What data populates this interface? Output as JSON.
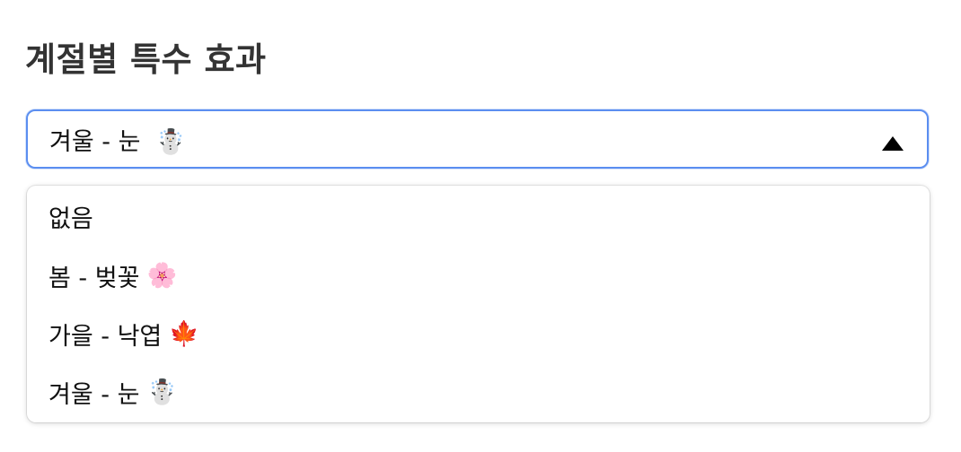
{
  "title": "계절별 특수 효과",
  "select": {
    "selected_label": "겨울 - 눈",
    "selected_icon": "snowman-icon",
    "selected_emoji": "☃️",
    "caret_icon": "caret-up-icon"
  },
  "options": [
    {
      "label": "없음",
      "emoji": "",
      "icon": ""
    },
    {
      "label": "봄 - 벚꽃",
      "emoji": "🌸",
      "icon": "cherry-blossom-icon"
    },
    {
      "label": "가을 - 낙엽",
      "emoji": "🍁",
      "icon": "maple-leaf-icon"
    },
    {
      "label": "겨울 - 눈",
      "emoji": "☃️",
      "icon": "snowman-icon"
    }
  ],
  "colors": {
    "focus_border": "#5b8ef0",
    "title": "#333333"
  }
}
